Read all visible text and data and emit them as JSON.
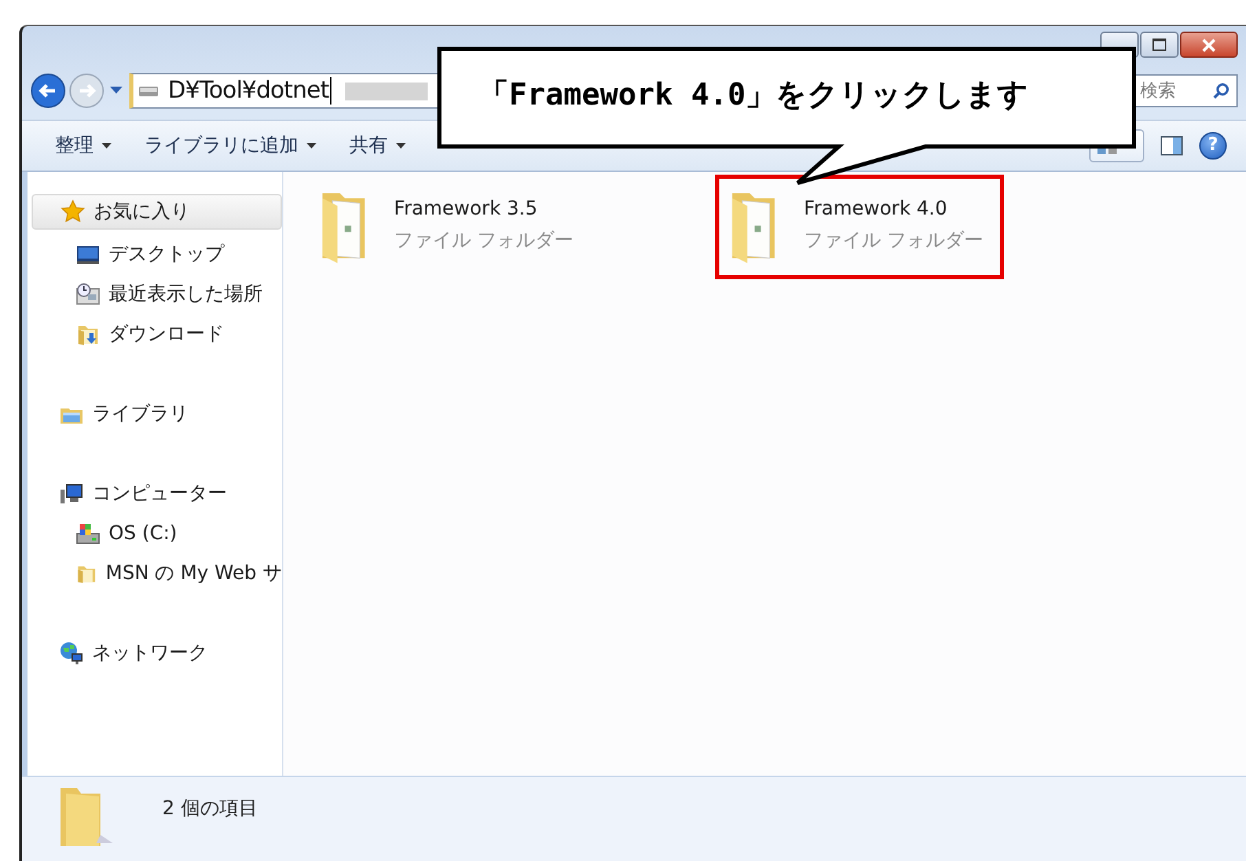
{
  "window": {
    "controls": [
      {
        "kind": "minimize"
      },
      {
        "kind": "maximize"
      },
      {
        "kind": "close"
      }
    ]
  },
  "navigation": {
    "back_enabled": true,
    "forward_enabled": false
  },
  "address": {
    "path": "D¥Tool¥dotnet"
  },
  "search": {
    "placeholder": "検索"
  },
  "toolbar": {
    "items": [
      {
        "label": "整理",
        "dropdown": true
      },
      {
        "label": "ライブラリに追加",
        "dropdown": true
      },
      {
        "label": "共有",
        "dropdown": true
      }
    ],
    "help": "?"
  },
  "sidebar": {
    "groups": [
      {
        "label": "お気に入り",
        "kind": "star",
        "selected": true,
        "children": [
          {
            "label": "デスクトップ",
            "kind": "desktop",
            "selected": false
          },
          {
            "label": "最近表示した場所",
            "kind": "recent",
            "selected": false
          },
          {
            "label": "ダウンロード",
            "kind": "download",
            "selected": false
          }
        ]
      },
      {
        "label": "ライブラリ",
        "kind": "library",
        "selected": false
      },
      {
        "label": "コンピューター",
        "kind": "computer",
        "selected": false,
        "children": [
          {
            "label": "OS (C:)",
            "kind": "drive",
            "selected": false
          },
          {
            "label": "MSN の My Web サ",
            "kind": "folder",
            "selected": false
          }
        ]
      },
      {
        "label": "ネットワーク",
        "kind": "network",
        "selected": false
      }
    ]
  },
  "files": [
    {
      "name": "Framework 3.5",
      "type": "ファイル フォルダー",
      "highlighted": false
    },
    {
      "name": "Framework 4.0",
      "type": "ファイル フォルダー",
      "highlighted": true
    }
  ],
  "status_bar": {
    "count": "2 個の項目"
  },
  "callout": {
    "text": "「Framework 4.0」をクリックします"
  }
}
